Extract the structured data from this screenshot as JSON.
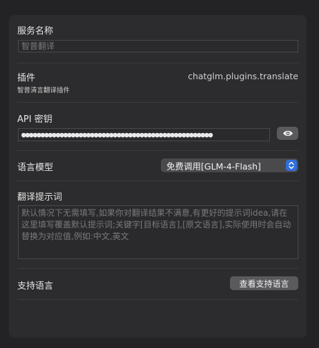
{
  "service_name": {
    "label": "服务名称",
    "placeholder": "智普翻译"
  },
  "plugin": {
    "label": "插件",
    "sublabel": "智普清言翻译插件",
    "id": "chatglm.plugins.translate"
  },
  "api_key": {
    "label": "API 密钥",
    "masked_value": "●●●●●●●●●●●●●●●●●●●●●●●●●●●●●●●●●●●●●●●●●●●●●●●●●●",
    "reveal_icon": "eye-icon"
  },
  "language_model": {
    "label": "语言模型",
    "selected": "免费调用[GLM-4-Flash]",
    "stepper_icon": "chevron-up-down-icon"
  },
  "prompt": {
    "label": "翻译提示词",
    "placeholder": "默认情况下无需填写,如果你对翻译结果不满意,有更好的提示词idea,请在这里填写覆盖默认提示词;关键字[目标语言],[原文语言],实际使用时会自动替换为对应值,例如:中文,英文"
  },
  "supported_languages": {
    "label": "支持语言",
    "button_label": "查看支持语言"
  },
  "colors": {
    "background": "#232325",
    "panel": "#2c2c2e",
    "accent": "#2f6fe0"
  }
}
